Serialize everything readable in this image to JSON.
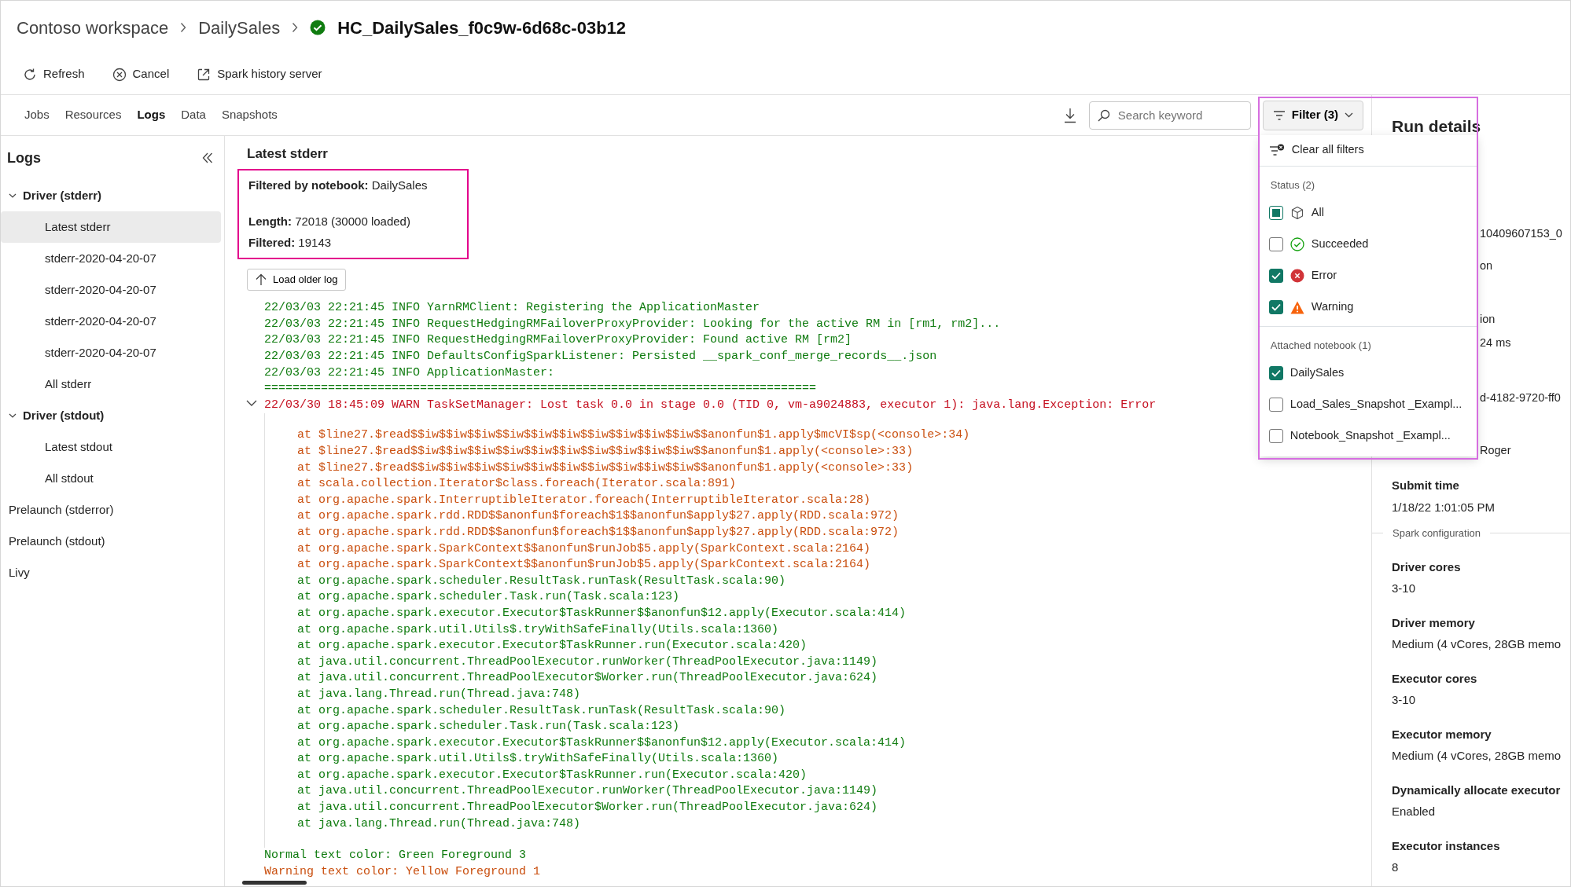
{
  "breadcrumb": [
    {
      "text": "Contoso workspace",
      "kind": "link"
    },
    {
      "text": "DailySales",
      "kind": "link"
    },
    {
      "text": "HC_DailySales_f0c9w-6d68c-03b12",
      "kind": "current",
      "succeeded": true
    }
  ],
  "toolbar": [
    {
      "label": "Refresh",
      "kind": "refresh"
    },
    {
      "label": "Cancel",
      "kind": "cancel"
    },
    {
      "label": "Spark history server",
      "kind": "external"
    }
  ],
  "tabs": [
    {
      "label": "Jobs",
      "selected": false
    },
    {
      "label": "Resources",
      "selected": false
    },
    {
      "label": "Logs",
      "selected": true
    },
    {
      "label": "Data",
      "selected": false
    },
    {
      "label": "Snapshots",
      "selected": false
    }
  ],
  "search": {
    "placeholder": "Search keyword"
  },
  "filter": {
    "label": "Filter (3)",
    "clear_label": "Clear all filters",
    "groups": [
      {
        "title": "Status (2)",
        "options": [
          {
            "label": "All",
            "kind": "all",
            "checked": true,
            "mixed": true
          },
          {
            "label": "Succeeded",
            "kind": "succeeded",
            "checked": false
          },
          {
            "label": "Error",
            "kind": "error",
            "checked": true
          },
          {
            "label": "Warning",
            "kind": "warning",
            "checked": true
          }
        ]
      },
      {
        "title": "Attached notebook (1)",
        "options": [
          {
            "label": "DailySales",
            "checked": true
          },
          {
            "label": "Load_Sales_Snapshot _Exampl...",
            "checked": false
          },
          {
            "label": "Notebook_Snapshot _Exampl...",
            "checked": false
          }
        ]
      }
    ]
  },
  "sidebar": {
    "title": "Logs",
    "items": [
      {
        "label": "Driver (stderr)",
        "expanded": true,
        "children": [
          {
            "label": "Latest stderr",
            "selected": true
          },
          {
            "label": "stderr-2020-04-20-07",
            "selected": false
          },
          {
            "label": "stderr-2020-04-20-07",
            "selected": false
          },
          {
            "label": "stderr-2020-04-20-07",
            "selected": false
          },
          {
            "label": "stderr-2020-04-20-07",
            "selected": false
          },
          {
            "label": "All stderr",
            "selected": false
          }
        ]
      },
      {
        "label": "Driver (stdout)",
        "expanded": true,
        "children": [
          {
            "label": "Latest stdout",
            "selected": false
          },
          {
            "label": "All stdout",
            "selected": false
          }
        ]
      },
      {
        "label": "Prelaunch (stderror)"
      },
      {
        "label": "Prelaunch (stdout)"
      },
      {
        "label": "Livy"
      }
    ]
  },
  "log": {
    "title": "Latest stderr",
    "summary": [
      {
        "label": "Filtered by notebook:",
        "value": "DailySales"
      },
      {
        "label": "Length:",
        "value": "72018 (30000 loaded)"
      },
      {
        "label": "Filtered:",
        "value": "19143"
      }
    ],
    "load_button": "Load older log",
    "lines": [
      {
        "kind": "info",
        "text": "22/03/03 22:21:45 INFO YarnRMClient: Registering the ApplicationMaster"
      },
      {
        "kind": "info",
        "text": "22/03/03 22:21:45 INFO RequestHedgingRMFailoverProxyProvider: Looking for the active RM in [rm1, rm2]..."
      },
      {
        "kind": "info",
        "text": "22/03/03 22:21:45 INFO RequestHedgingRMFailoverProxyProvider: Found active RM [rm2]"
      },
      {
        "kind": "info",
        "text": "22/03/03 22:21:45 INFO DefaultsConfigSparkListener: Persisted __spark_conf_merge_records__.json"
      },
      {
        "kind": "info",
        "text": "22/03/03 22:21:45 INFO ApplicationMaster:"
      },
      {
        "kind": "info",
        "text": "=============================================================================="
      },
      {
        "kind": "error",
        "expanded": true,
        "text": "22/03/30 18:45:09 WARN TaskSetManager: Lost task 0.0 in stage 0.0 (TID 0, vm-a9024883, executor 1): java.lang.Exception: Error",
        "children": [
          {
            "kind": "warning",
            "text": "at $line27.$read$$iw$$iw$$iw$$iw$$iw$$iw$$iw$$iw$$iw$$iw$$anonfun$1.apply$mcVI$sp(<console>:34)"
          },
          {
            "kind": "warning",
            "text": "at $line27.$read$$iw$$iw$$iw$$iw$$iw$$iw$$iw$$iw$$iw$$iw$$anonfun$1.apply(<console>:33)"
          },
          {
            "kind": "warning",
            "text": "at $line27.$read$$iw$$iw$$iw$$iw$$iw$$iw$$iw$$iw$$iw$$iw$$anonfun$1.apply(<console>:33)"
          },
          {
            "kind": "warning",
            "text": "at scala.collection.Iterator$class.foreach(Iterator.scala:891)"
          },
          {
            "kind": "warning",
            "text": "at org.apache.spark.InterruptibleIterator.foreach(InterruptibleIterator.scala:28)"
          },
          {
            "kind": "warning",
            "text": "at org.apache.spark.rdd.RDD$$anonfun$foreach$1$$anonfun$apply$27.apply(RDD.scala:972)"
          },
          {
            "kind": "warning",
            "text": "at org.apache.spark.rdd.RDD$$anonfun$foreach$1$$anonfun$apply$27.apply(RDD.scala:972)"
          },
          {
            "kind": "warning",
            "text": "at org.apache.spark.SparkContext$$anonfun$runJob$5.apply(SparkContext.scala:2164)"
          },
          {
            "kind": "warning",
            "text": "at org.apache.spark.SparkContext$$anonfun$runJob$5.apply(SparkContext.scala:2164)"
          },
          {
            "kind": "info",
            "text": "at org.apache.spark.scheduler.ResultTask.runTask(ResultTask.scala:90)"
          },
          {
            "kind": "info",
            "text": "at org.apache.spark.scheduler.Task.run(Task.scala:123)"
          },
          {
            "kind": "info",
            "text": "at org.apache.spark.executor.Executor$TaskRunner$$anonfun$12.apply(Executor.scala:414)"
          },
          {
            "kind": "info",
            "text": "at org.apache.spark.util.Utils$.tryWithSafeFinally(Utils.scala:1360)"
          },
          {
            "kind": "info",
            "text": "at org.apache.spark.executor.Executor$TaskRunner.run(Executor.scala:420)"
          },
          {
            "kind": "info",
            "text": "at java.util.concurrent.ThreadPoolExecutor.runWorker(ThreadPoolExecutor.java:1149)"
          },
          {
            "kind": "info",
            "text": "at java.util.concurrent.ThreadPoolExecutor$Worker.run(ThreadPoolExecutor.java:624)"
          },
          {
            "kind": "info",
            "text": "at java.lang.Thread.run(Thread.java:748)"
          },
          {
            "kind": "info",
            "text": "at org.apache.spark.scheduler.ResultTask.runTask(ResultTask.scala:90)"
          },
          {
            "kind": "info",
            "text": "at org.apache.spark.scheduler.Task.run(Task.scala:123)"
          },
          {
            "kind": "info",
            "text": "at org.apache.spark.executor.Executor$TaskRunner$$anonfun$12.apply(Executor.scala:414)"
          },
          {
            "kind": "info",
            "text": "at org.apache.spark.util.Utils$.tryWithSafeFinally(Utils.scala:1360)"
          },
          {
            "kind": "info",
            "text": "at org.apache.spark.executor.Executor$TaskRunner.run(Executor.scala:420)"
          },
          {
            "kind": "info",
            "text": "at java.util.concurrent.ThreadPoolExecutor.runWorker(ThreadPoolExecutor.java:1149)"
          },
          {
            "kind": "info",
            "text": "at java.util.concurrent.ThreadPoolExecutor$Worker.run(ThreadPoolExecutor.java:624)"
          },
          {
            "kind": "info",
            "text": "at java.lang.Thread.run(Thread.java:748)"
          }
        ]
      },
      {
        "kind": "info",
        "text": "Normal text color: Green Foreground 3"
      },
      {
        "kind": "warning",
        "text": "Warning text color: Yellow Foreground 1"
      }
    ]
  },
  "run_details": {
    "title": "Run details",
    "fragments": [
      "10409607153_0",
      "on",
      "ion",
      "24 ms",
      "d-4182-9720-ff0",
      "Roger"
    ],
    "fields": [
      {
        "label": "Submit time",
        "value": "1/18/22 1:01:05 PM"
      }
    ],
    "section": "Spark configuration",
    "config": [
      {
        "label": "Driver cores",
        "value": "3-10"
      },
      {
        "label": "Driver memory",
        "value": "Medium (4 vCores, 28GB memo"
      },
      {
        "label": "Executor cores",
        "value": "3-10"
      },
      {
        "label": "Executor memory",
        "value": "Medium (4 vCores, 28GB memo"
      },
      {
        "label": "Dynamically allocate executor",
        "value": "Enabled"
      },
      {
        "label": "Executor instances",
        "value": "8"
      }
    ]
  }
}
